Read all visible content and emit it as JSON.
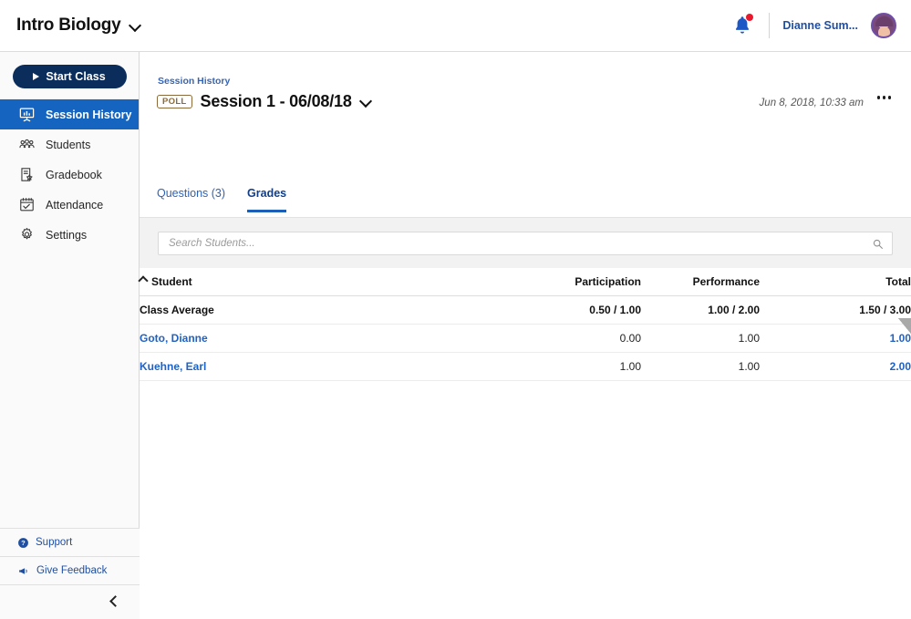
{
  "topbar": {
    "course_title": "Intro Biology",
    "course_caret": "chevron-down",
    "notifications_icon": "bell-icon",
    "user_name": "Dianne Sum...",
    "avatar": "user-avatar"
  },
  "sidebar": {
    "start_class_label": "Start Class",
    "items": [
      {
        "label": "Session History",
        "icon": "presentation-icon",
        "active": true
      },
      {
        "label": "Students",
        "icon": "people-icon",
        "active": false
      },
      {
        "label": "Gradebook",
        "icon": "gradebook-icon",
        "active": false
      },
      {
        "label": "Attendance",
        "icon": "calendar-check-icon",
        "active": false
      },
      {
        "label": "Settings",
        "icon": "gear-icon",
        "active": false
      }
    ],
    "support_label": "Support",
    "feedback_label": "Give Feedback",
    "collapse_icon": "chevron-left-icon"
  },
  "main": {
    "breadcrumb": "Session History",
    "badge": "POLL",
    "session_title": "Session 1 - 06/08/18",
    "session_timestamp": "Jun 8, 2018, 10:33 am",
    "more_menu": "kebab-menu",
    "tabs": [
      {
        "label": "Questions (3)",
        "active": false
      },
      {
        "label": "Grades",
        "active": true
      }
    ],
    "search": {
      "value": "",
      "placeholder": "Search Students...",
      "icon": "search-icon"
    },
    "table": {
      "columns": [
        "Student",
        "Participation",
        "Performance",
        "Total"
      ],
      "sort_column": "Student",
      "sort_direction": "ascending",
      "average_row": {
        "label": "Class Average",
        "participation": "0.50 / 1.00",
        "performance": "1.00 / 2.00",
        "total": "1.50 / 3.00"
      },
      "rows": [
        {
          "name": "Goto, Dianne",
          "participation": "0.00",
          "performance": "1.00",
          "total": "1.00"
        },
        {
          "name": "Kuehne, Earl",
          "participation": "1.00",
          "performance": "1.00",
          "total": "2.00"
        }
      ]
    }
  },
  "colors": {
    "brand_navy": "#0b2d5c",
    "accent_blue": "#1565c0",
    "link_blue": "#1f62c4",
    "badge_brown": "#8a6a3a",
    "notification_red": "#e8192c"
  }
}
